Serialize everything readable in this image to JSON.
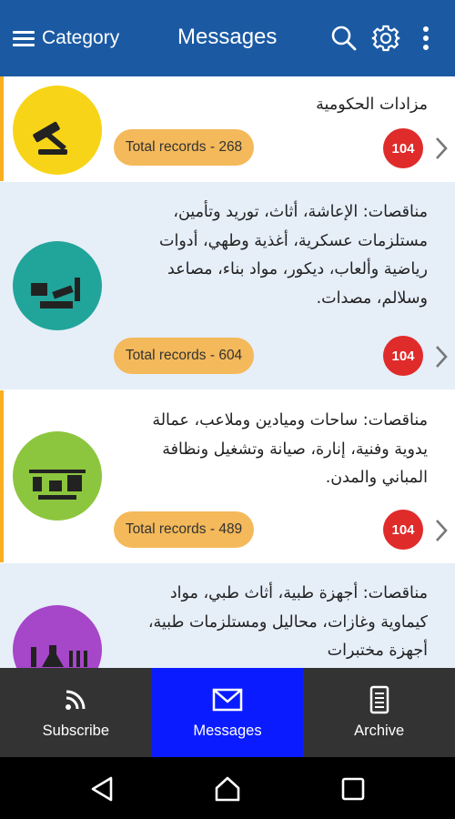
{
  "appbar": {
    "category_label": "Category",
    "title": "Messages",
    "icons": [
      "hamburger-icon",
      "search-icon",
      "gear-icon",
      "more-vertical-icon"
    ]
  },
  "items": [
    {
      "logo_text": "مزادات حكومية",
      "logo_color": "#f7d417",
      "title": "مزادات الحكومية",
      "records": "Total records - 268",
      "badge": "104",
      "background": "white"
    },
    {
      "logo_text": "مناقصات",
      "logo_color": "#21a59a",
      "title": "مناقصات: الإعاشة، أثاث، توريد وتأمين، مستلزمات عسكرية، أغذية وطهي، أدوات رياضية وألعاب، ديكور، مواد بناء، مصاعد وسلالم، مصدات.",
      "records": "Total records - 604",
      "badge": "104",
      "background": "alt"
    },
    {
      "logo_text": "مناقصات",
      "logo_color": "#8cc63e",
      "title": "مناقصات: ساحات وميادين وملاعب، عمالة يدوية وفنية، إنارة، صيانة وتشغيل ونظافة المباني والمدن.",
      "records": "Total records - 489",
      "badge": "104",
      "background": "white"
    },
    {
      "logo_text": "مناقصات",
      "logo_color": "#a646c9",
      "title": "مناقصات: أجهزة طبية، أثاث طبي، مواد كيماوية وغازات، محاليل ومستلزمات طبية، أجهزة مختبرات",
      "records": "",
      "badge": "",
      "background": "alt"
    }
  ],
  "bottom_nav": {
    "subscribe": "Subscribe",
    "messages": "Messages",
    "archive": "Archive",
    "active": "messages"
  },
  "colors": {
    "appbar": "#1b5aa3",
    "accent": "#f7b022",
    "badge": "#e02b2b",
    "records_pill": "#f4b95a",
    "active_tab": "#0a1cff",
    "bottom_nav": "#333333"
  }
}
